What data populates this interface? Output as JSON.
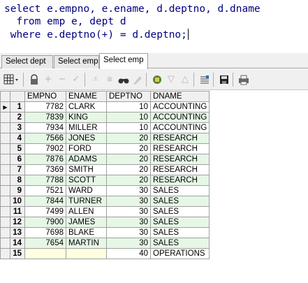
{
  "editor": {
    "lines": [
      "select e.empno, e.ename, d.deptno, d.dname",
      "  from emp e, dept d",
      " where e.deptno(+) = d.deptno;"
    ]
  },
  "tabs": [
    {
      "label": "Select dept"
    },
    {
      "label": "Select emp"
    },
    {
      "label": "Select emp",
      "active": true
    }
  ],
  "toolbar": {
    "icons": [
      "grid-menu-icon",
      "lock-icon",
      "add-record-icon",
      "delete-record-icon",
      "post-edit-icon",
      "filter-down-icon",
      "filter-down-all-icon",
      "find-icon",
      "clear-icon",
      "query-by-example-icon",
      "filter-icon",
      "sort-asc-icon",
      "sort-desc-icon",
      "export-icon",
      "save-icon",
      "print-icon"
    ]
  },
  "grid": {
    "columns": [
      "EMPNO",
      "ENAME",
      "DEPTNO",
      "DNAME"
    ],
    "rows": [
      [
        "1",
        "7782",
        "CLARK",
        "10",
        "ACCOUNTING"
      ],
      [
        "2",
        "7839",
        "KING",
        "10",
        "ACCOUNTING"
      ],
      [
        "3",
        "7934",
        "MILLER",
        "10",
        "ACCOUNTING"
      ],
      [
        "4",
        "7566",
        "JONES",
        "20",
        "RESEARCH"
      ],
      [
        "5",
        "7902",
        "FORD",
        "20",
        "RESEARCH"
      ],
      [
        "6",
        "7876",
        "ADAMS",
        "20",
        "RESEARCH"
      ],
      [
        "7",
        "7369",
        "SMITH",
        "20",
        "RESEARCH"
      ],
      [
        "8",
        "7788",
        "SCOTT",
        "20",
        "RESEARCH"
      ],
      [
        "9",
        "7521",
        "WARD",
        "30",
        "SALES"
      ],
      [
        "10",
        "7844",
        "TURNER",
        "30",
        "SALES"
      ],
      [
        "11",
        "7499",
        "ALLEN",
        "30",
        "SALES"
      ],
      [
        "12",
        "7900",
        "JAMES",
        "30",
        "SALES"
      ],
      [
        "13",
        "7698",
        "BLAKE",
        "30",
        "SALES"
      ],
      [
        "14",
        "7654",
        "MARTIN",
        "30",
        "SALES"
      ],
      [
        "15",
        "",
        "",
        "40",
        "OPERATIONS"
      ]
    ],
    "current_row_indicator": "▶"
  },
  "colors": {
    "sql_text": "#000080",
    "row_alt": "#e6f7e6",
    "null_cell": "#ffffe0"
  }
}
